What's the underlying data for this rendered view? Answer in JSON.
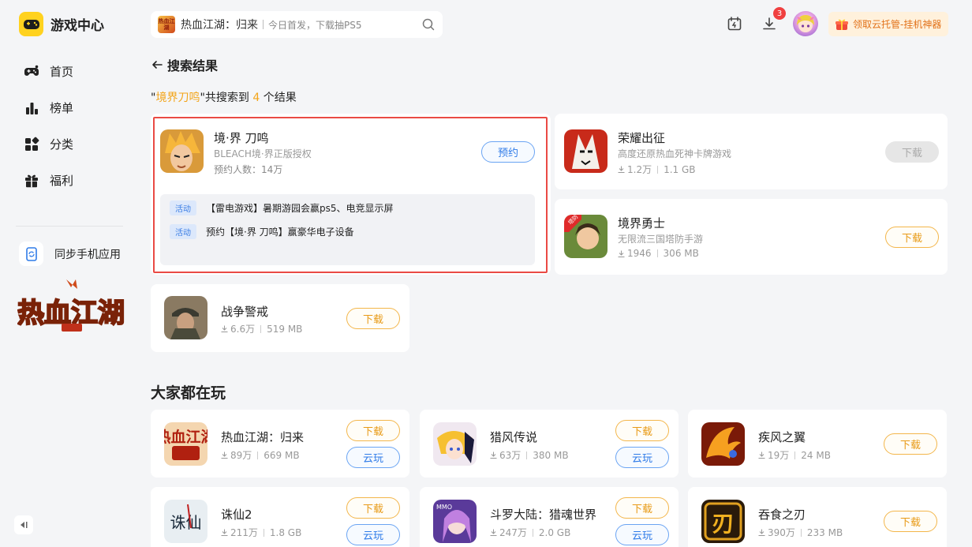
{
  "app": {
    "title": "游戏中心"
  },
  "nav": [
    {
      "label": "首页",
      "icon": "gamepad-icon"
    },
    {
      "label": "榜单",
      "icon": "bar-chart-icon"
    },
    {
      "label": "分类",
      "icon": "grid-icon"
    },
    {
      "label": "福利",
      "icon": "gift-icon"
    }
  ],
  "sidebar": {
    "sync_label": "同步手机应用",
    "promo_logo_text": "热血江湖"
  },
  "search": {
    "thumb_text": "热血江湖",
    "game": "热血江湖：归来",
    "hint": "今日首发，下载抽PS5"
  },
  "topbar": {
    "download_badge": "3",
    "cloud_label": "领取云托管-挂机神器"
  },
  "page": {
    "back_title": "搜索结果",
    "summary_prefix": "\"",
    "query": "境界刀鸣",
    "summary_mid": "\"共搜索到 ",
    "count": "4",
    "summary_suffix": " 个结果"
  },
  "results": {
    "featured": {
      "name": "境·界 刀鸣",
      "desc": "BLEACH境·界正版授权",
      "stat": "预约人数：14万",
      "button": "预约",
      "activities": [
        {
          "tag": "活动",
          "text": "【雷电游戏】暑期游园会赢ps5、电竞显示屏"
        },
        {
          "tag": "活动",
          "text": "预约【境·界 刀鸣】赢豪华电子设备"
        }
      ]
    },
    "r2": {
      "name": "荣耀出征",
      "desc": "高度还原热血死神卡牌游戏",
      "downloads": "1.2万",
      "size": "1.1 GB",
      "button": "下载"
    },
    "r3": {
      "name": "境界勇士",
      "desc": "无限流三国塔防手游",
      "downloads": "1946",
      "size": "306 MB",
      "button": "下载",
      "icon_tag": "塔防"
    },
    "r4": {
      "name": "战争警戒",
      "downloads": "6.6万",
      "size": "519 MB",
      "button": "下载"
    }
  },
  "popular": {
    "title": "大家都在玩",
    "games": [
      {
        "name": "热血江湖：归来",
        "downloads": "89万",
        "size": "669 MB",
        "download": "下载",
        "cloud": "云玩",
        "icon_text": "热血江湖"
      },
      {
        "name": "猎风传说",
        "downloads": "63万",
        "size": "380 MB",
        "download": "下载",
        "cloud": "云玩"
      },
      {
        "name": "疾风之翼",
        "downloads": "19万",
        "size": "24 MB",
        "download": "下载"
      },
      {
        "name": "诛仙2",
        "downloads": "211万",
        "size": "1.8 GB",
        "download": "下载",
        "cloud": "云玩",
        "icon_text": "诛仙"
      },
      {
        "name": "斗罗大陆：猎魂世界",
        "downloads": "247万",
        "size": "2.0 GB",
        "download": "下载",
        "cloud": "云玩",
        "icon_text": "MMO"
      },
      {
        "name": "吞食之刃",
        "downloads": "390万",
        "size": "233 MB",
        "download": "下载",
        "icon_text": "刃"
      }
    ]
  },
  "colors": {
    "accent": "#f3a51a",
    "blue": "#2f7be8",
    "highlight_border": "#ea4a44",
    "logo_yellow": "#ffd21f"
  }
}
